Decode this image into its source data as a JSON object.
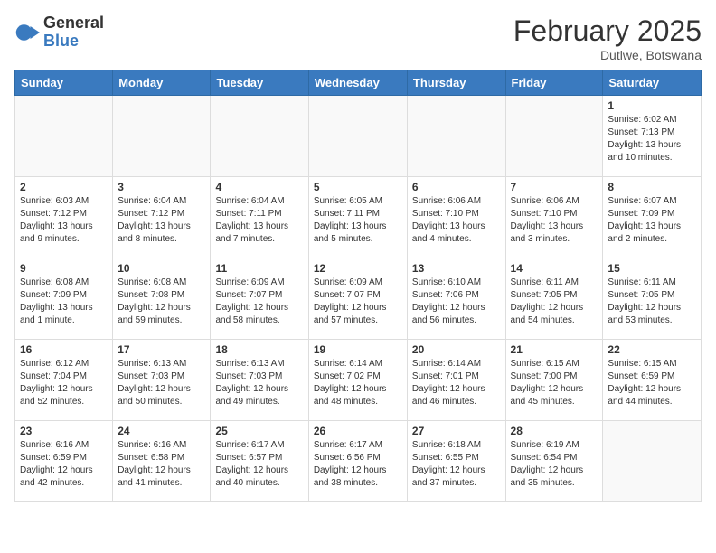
{
  "logo": {
    "general": "General",
    "blue": "Blue"
  },
  "title": "February 2025",
  "location": "Dutlwe, Botswana",
  "days_of_week": [
    "Sunday",
    "Monday",
    "Tuesday",
    "Wednesday",
    "Thursday",
    "Friday",
    "Saturday"
  ],
  "weeks": [
    [
      {
        "day": "",
        "info": ""
      },
      {
        "day": "",
        "info": ""
      },
      {
        "day": "",
        "info": ""
      },
      {
        "day": "",
        "info": ""
      },
      {
        "day": "",
        "info": ""
      },
      {
        "day": "",
        "info": ""
      },
      {
        "day": "1",
        "info": "Sunrise: 6:02 AM\nSunset: 7:13 PM\nDaylight: 13 hours\nand 10 minutes."
      }
    ],
    [
      {
        "day": "2",
        "info": "Sunrise: 6:03 AM\nSunset: 7:12 PM\nDaylight: 13 hours\nand 9 minutes."
      },
      {
        "day": "3",
        "info": "Sunrise: 6:04 AM\nSunset: 7:12 PM\nDaylight: 13 hours\nand 8 minutes."
      },
      {
        "day": "4",
        "info": "Sunrise: 6:04 AM\nSunset: 7:11 PM\nDaylight: 13 hours\nand 7 minutes."
      },
      {
        "day": "5",
        "info": "Sunrise: 6:05 AM\nSunset: 7:11 PM\nDaylight: 13 hours\nand 5 minutes."
      },
      {
        "day": "6",
        "info": "Sunrise: 6:06 AM\nSunset: 7:10 PM\nDaylight: 13 hours\nand 4 minutes."
      },
      {
        "day": "7",
        "info": "Sunrise: 6:06 AM\nSunset: 7:10 PM\nDaylight: 13 hours\nand 3 minutes."
      },
      {
        "day": "8",
        "info": "Sunrise: 6:07 AM\nSunset: 7:09 PM\nDaylight: 13 hours\nand 2 minutes."
      }
    ],
    [
      {
        "day": "9",
        "info": "Sunrise: 6:08 AM\nSunset: 7:09 PM\nDaylight: 13 hours\nand 1 minute."
      },
      {
        "day": "10",
        "info": "Sunrise: 6:08 AM\nSunset: 7:08 PM\nDaylight: 12 hours\nand 59 minutes."
      },
      {
        "day": "11",
        "info": "Sunrise: 6:09 AM\nSunset: 7:07 PM\nDaylight: 12 hours\nand 58 minutes."
      },
      {
        "day": "12",
        "info": "Sunrise: 6:09 AM\nSunset: 7:07 PM\nDaylight: 12 hours\nand 57 minutes."
      },
      {
        "day": "13",
        "info": "Sunrise: 6:10 AM\nSunset: 7:06 PM\nDaylight: 12 hours\nand 56 minutes."
      },
      {
        "day": "14",
        "info": "Sunrise: 6:11 AM\nSunset: 7:05 PM\nDaylight: 12 hours\nand 54 minutes."
      },
      {
        "day": "15",
        "info": "Sunrise: 6:11 AM\nSunset: 7:05 PM\nDaylight: 12 hours\nand 53 minutes."
      }
    ],
    [
      {
        "day": "16",
        "info": "Sunrise: 6:12 AM\nSunset: 7:04 PM\nDaylight: 12 hours\nand 52 minutes."
      },
      {
        "day": "17",
        "info": "Sunrise: 6:13 AM\nSunset: 7:03 PM\nDaylight: 12 hours\nand 50 minutes."
      },
      {
        "day": "18",
        "info": "Sunrise: 6:13 AM\nSunset: 7:03 PM\nDaylight: 12 hours\nand 49 minutes."
      },
      {
        "day": "19",
        "info": "Sunrise: 6:14 AM\nSunset: 7:02 PM\nDaylight: 12 hours\nand 48 minutes."
      },
      {
        "day": "20",
        "info": "Sunrise: 6:14 AM\nSunset: 7:01 PM\nDaylight: 12 hours\nand 46 minutes."
      },
      {
        "day": "21",
        "info": "Sunrise: 6:15 AM\nSunset: 7:00 PM\nDaylight: 12 hours\nand 45 minutes."
      },
      {
        "day": "22",
        "info": "Sunrise: 6:15 AM\nSunset: 6:59 PM\nDaylight: 12 hours\nand 44 minutes."
      }
    ],
    [
      {
        "day": "23",
        "info": "Sunrise: 6:16 AM\nSunset: 6:59 PM\nDaylight: 12 hours\nand 42 minutes."
      },
      {
        "day": "24",
        "info": "Sunrise: 6:16 AM\nSunset: 6:58 PM\nDaylight: 12 hours\nand 41 minutes."
      },
      {
        "day": "25",
        "info": "Sunrise: 6:17 AM\nSunset: 6:57 PM\nDaylight: 12 hours\nand 40 minutes."
      },
      {
        "day": "26",
        "info": "Sunrise: 6:17 AM\nSunset: 6:56 PM\nDaylight: 12 hours\nand 38 minutes."
      },
      {
        "day": "27",
        "info": "Sunrise: 6:18 AM\nSunset: 6:55 PM\nDaylight: 12 hours\nand 37 minutes."
      },
      {
        "day": "28",
        "info": "Sunrise: 6:19 AM\nSunset: 6:54 PM\nDaylight: 12 hours\nand 35 minutes."
      },
      {
        "day": "",
        "info": ""
      }
    ]
  ]
}
